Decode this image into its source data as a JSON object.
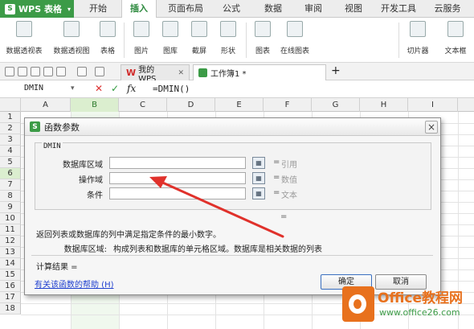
{
  "app": {
    "title": "WPS 表格"
  },
  "menu": [
    "开始",
    "插入",
    "页面布局",
    "公式",
    "数据",
    "审阅",
    "视图",
    "开发工具",
    "云服务"
  ],
  "ribbon": {
    "items": [
      "数据透视表",
      "数据透视图",
      "表格",
      "图片",
      "图库",
      "截屏",
      "形状",
      "图表",
      "在线图表",
      "切片器",
      "文本框"
    ]
  },
  "tabs": [
    {
      "label": "我的WPS"
    },
    {
      "label": "工作簿1 *"
    }
  ],
  "formula_bar": {
    "name": "DMIN",
    "cancel": "✕",
    "confirm": "✓",
    "fx": "fx",
    "formula": "=DMIN()"
  },
  "sheet": {
    "columns": [
      "A",
      "B",
      "C",
      "D",
      "E",
      "F",
      "G",
      "H",
      "I"
    ],
    "rows": [
      "1",
      "2",
      "3",
      "4",
      "5",
      "6",
      "7",
      "8",
      "9",
      "10",
      "11",
      "12",
      "13",
      "14",
      "15",
      "16",
      "17",
      "18"
    ]
  },
  "dialog": {
    "title": "函数参数",
    "function": "DMIN",
    "args": [
      {
        "label": "数据库区域",
        "eq": "=",
        "value": "引用"
      },
      {
        "label": "操作域",
        "eq": "=",
        "value": "数值"
      },
      {
        "label": "条件",
        "eq": "=",
        "value": "文本"
      }
    ],
    "result_eq": "=",
    "description": "返回列表或数据库的列中满足指定条件的最小数字。",
    "arg_desc_name": "数据库区域:",
    "arg_desc_text": "构成列表和数据库的单元格区域。数据库是相关数据的列表",
    "calc_label": "计算结果 =",
    "help": "有关该函数的帮助 (H)",
    "ok": "确定",
    "cancel": "取消"
  },
  "watermark": {
    "line1": "Office教程网",
    "line2": "www.office26.com"
  },
  "colors": {
    "accent": "#3c9b47",
    "arrow": "#e0312b",
    "watermark": "#e8711d"
  }
}
